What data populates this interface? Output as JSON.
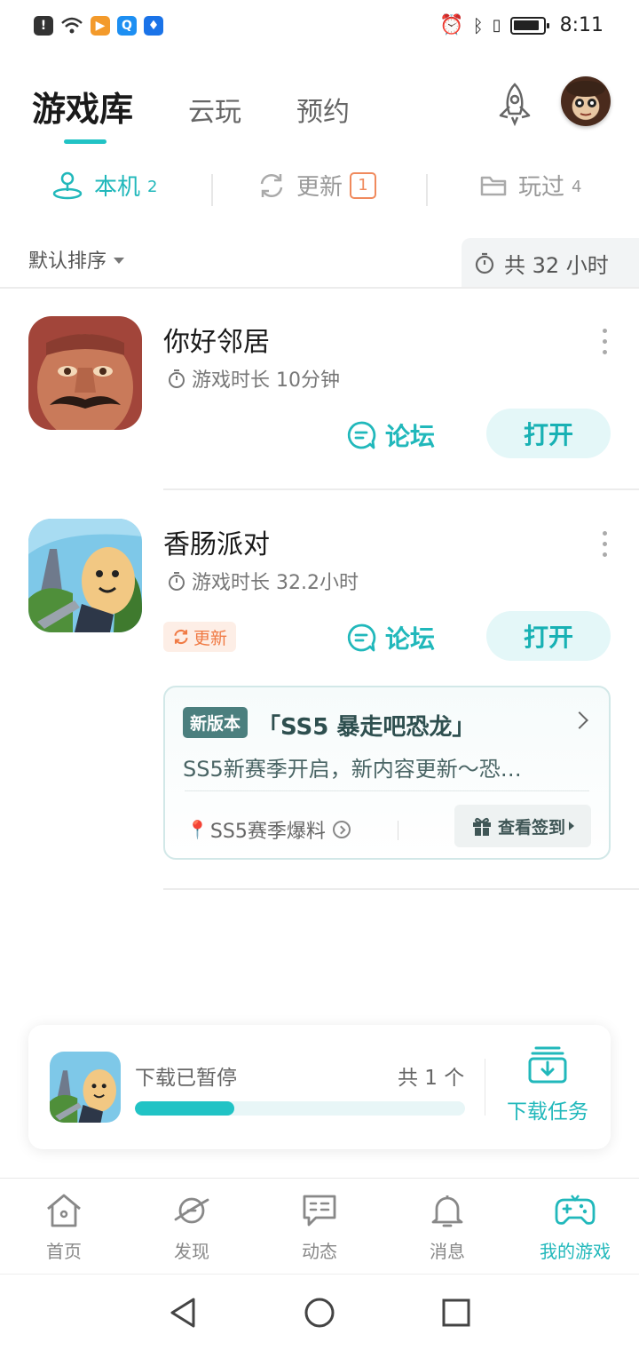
{
  "status_bar": {
    "time": "8:11"
  },
  "header": {
    "tabs": [
      {
        "label": "游戏库",
        "active": true
      },
      {
        "label": "云玩",
        "active": false
      },
      {
        "label": "预约",
        "active": false
      }
    ]
  },
  "sub_tabs": [
    {
      "label": "本机",
      "count": "2",
      "icon": "person-pin-icon",
      "active": true
    },
    {
      "label": "更新",
      "badge": "1",
      "icon": "refresh-icon",
      "active": false
    },
    {
      "label": "玩过",
      "count": "4",
      "icon": "folder-icon",
      "active": false
    }
  ],
  "sort": {
    "label": "默认排序"
  },
  "total_time": {
    "label": "共 32 小时"
  },
  "games": [
    {
      "name": "你好邻居",
      "playtime": "游戏时长 10分钟",
      "forum_label": "论坛",
      "open_label": "打开"
    },
    {
      "name": "香肠派对",
      "playtime": "游戏时长 32.2小时",
      "forum_label": "论坛",
      "open_label": "打开",
      "update_tag": "更新"
    }
  ],
  "version_card": {
    "tag": "新版本",
    "title": "「SS5 暴走吧恐龙」",
    "description": "SS5新赛季开启，新内容更新～恐…",
    "link": "SS5赛季爆料",
    "checkin_label": "查看签到"
  },
  "download": {
    "status": "下载已暂停",
    "count": "共 1 个",
    "progress": 0.3,
    "task_label": "下载任务"
  },
  "bottom_nav": [
    {
      "label": "首页",
      "icon": "home-icon",
      "active": false
    },
    {
      "label": "发现",
      "icon": "planet-icon",
      "active": false
    },
    {
      "label": "动态",
      "icon": "chat-icon",
      "active": false
    },
    {
      "label": "消息",
      "icon": "bell-icon",
      "active": false
    },
    {
      "label": "我的游戏",
      "icon": "gamepad-icon",
      "active": true
    }
  ],
  "colors": {
    "accent": "#21c3c5",
    "update": "#f07a44"
  }
}
